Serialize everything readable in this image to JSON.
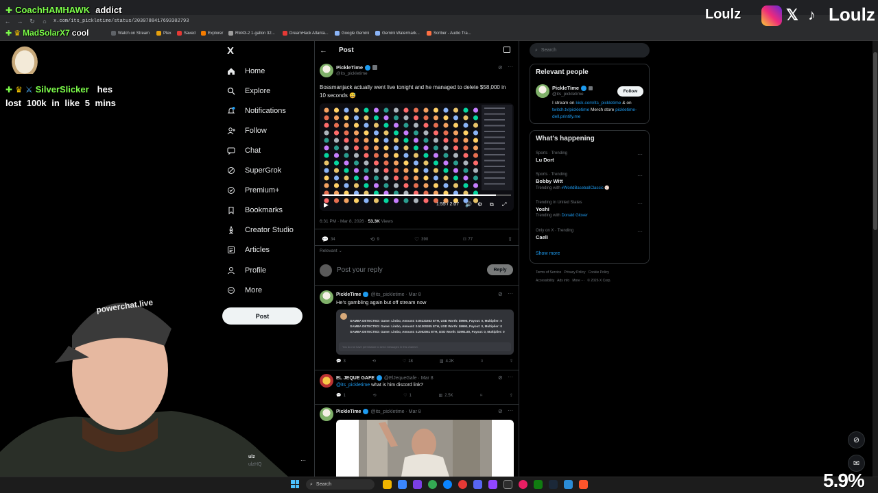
{
  "browser": {
    "url": "x.com/its_pickletime/status/2030788417693302793",
    "bookmarks": [
      "Watch on Stream",
      "Plex",
      "Saved",
      "Explorer",
      "RM43-2 1-gallon 32...",
      "DreamHack Atlanta...",
      "Google Gemini",
      "Gemini Watermark...",
      "Scriber - Audio Tra..."
    ]
  },
  "overlay": {
    "chat_top_user": "CoachHAMHAWK",
    "chat_top_msg": "addict",
    "chat_second_user": "MadSolarX7",
    "chat_second_msg": "cool",
    "chat_third_user": "SilverSlicker",
    "chat_third_line1": "hes",
    "chat_third_line2": "lost 100k in like 5 mins",
    "brand_left": "Loulz",
    "brand_right": "Loulz",
    "hat_text": "powerchat.live",
    "percent": "5.9%",
    "colors": {
      "chat_green": "#7dff4a",
      "chat_blue": "#4fb3ff"
    }
  },
  "sidebar": {
    "logo": "X",
    "items": [
      {
        "label": "Home",
        "icon": "home-icon"
      },
      {
        "label": "Explore",
        "icon": "search-icon"
      },
      {
        "label": "Notifications",
        "icon": "bell-icon"
      },
      {
        "label": "Follow",
        "icon": "person-plus-icon"
      },
      {
        "label": "Chat",
        "icon": "chat-icon"
      },
      {
        "label": "SuperGrok",
        "icon": "grok-icon"
      },
      {
        "label": "Premium+",
        "icon": "premium-icon"
      },
      {
        "label": "Bookmarks",
        "icon": "bookmark-icon"
      },
      {
        "label": "Creator Studio",
        "icon": "creator-icon"
      },
      {
        "label": "Articles",
        "icon": "article-icon"
      },
      {
        "label": "Profile",
        "icon": "person-icon"
      },
      {
        "label": "More",
        "icon": "more-circle-icon"
      }
    ],
    "post_label": "Post",
    "account_name": "ulz",
    "account_handle": "ulzHQ"
  },
  "main": {
    "header_title": "Post",
    "tweet": {
      "author": "PickleTime",
      "handle": "@its_pickletime",
      "text": "Bossmanjack actually went live tonight and he managed to delete $58,000 in 10 seconds 😅",
      "video_time": "1:55 / 2:07",
      "timestamp": "6:31 PM · Mar 8, 2026 · ",
      "views_count": "53.3K",
      "views_label": " Views",
      "replies": "34",
      "reposts": "9",
      "likes": "390",
      "bookmarks": "77"
    },
    "sort_label": "Relevant",
    "reply_placeholder": "Post your reply",
    "reply_button": "Reply",
    "replies": [
      {
        "author": "PickleTime",
        "handle": "@its_pickletime · Mar 8",
        "text": "He's gambling again but off stream now",
        "embed_lines": [
          "GAMBA DETECTED: Game: Limbo, Amount: 0.05131653 ETH, USD Worth: $9995, Payout: 0, Multiplier: 0",
          "GAMBA DETECTED: Game: Limbo, Amount: 0.51300305 ETH, USD Worth: $9990, Payout: 0, Multiplier: 0",
          "GAMBA DETECTED: Game: Limbo, Amount: 0.2052061 ETH, USD Worth: $3991.80, Payout: 0, Multiplier: 0"
        ],
        "embed_footer": "You do not have permission to send messages in this channel.",
        "replies": "3",
        "likes": "18",
        "views": "4.2K"
      },
      {
        "author": "EL JEQUE GAFE",
        "handle": "@ElJequeGafe · Mar 8",
        "mention": "@its_pickletime",
        "text": " what is him discord link?",
        "replies": "1",
        "likes": "1",
        "views": "2.5K"
      },
      {
        "author": "PickleTime",
        "handle": "@its_pickletime · Mar 8"
      }
    ]
  },
  "right": {
    "search_placeholder": "Search",
    "relevant_title": "Relevant people",
    "person_name": "PickleTime",
    "person_handle": "@its_pickletime",
    "follow_label": "Follow",
    "bio_1": "I stream on ",
    "bio_link1": "kick.com/its_pickletime",
    "bio_2": " & on ",
    "bio_link2": "twitch.tv/pickletime",
    "bio_3": " Merch store ",
    "bio_link3": "pickletime-dell.printify.me",
    "happening_title": "What's happening",
    "trends": [
      {
        "cat": "Sports · Trending",
        "name": "Lu Dort",
        "sub": ""
      },
      {
        "cat": "Sports · Trending",
        "name": "Bobby Witt",
        "sub_pre": "Trending with ",
        "sub_link": "#WorldBaseballClassic"
      },
      {
        "cat": "Trending in United States",
        "name": "Yoshi",
        "sub_pre": "Trending with ",
        "sub_link": "Donald Glover"
      },
      {
        "cat": "Only on X · Trending",
        "name": "Caeli",
        "sub": ""
      }
    ],
    "show_more": "Show more",
    "footer_1": "Terms of Service   Privacy Policy   Cookie Policy",
    "footer_2": "Accessibility   Ads info   More ···   © 2026 X Corp."
  },
  "taskbar": {
    "search_label": "Search"
  }
}
